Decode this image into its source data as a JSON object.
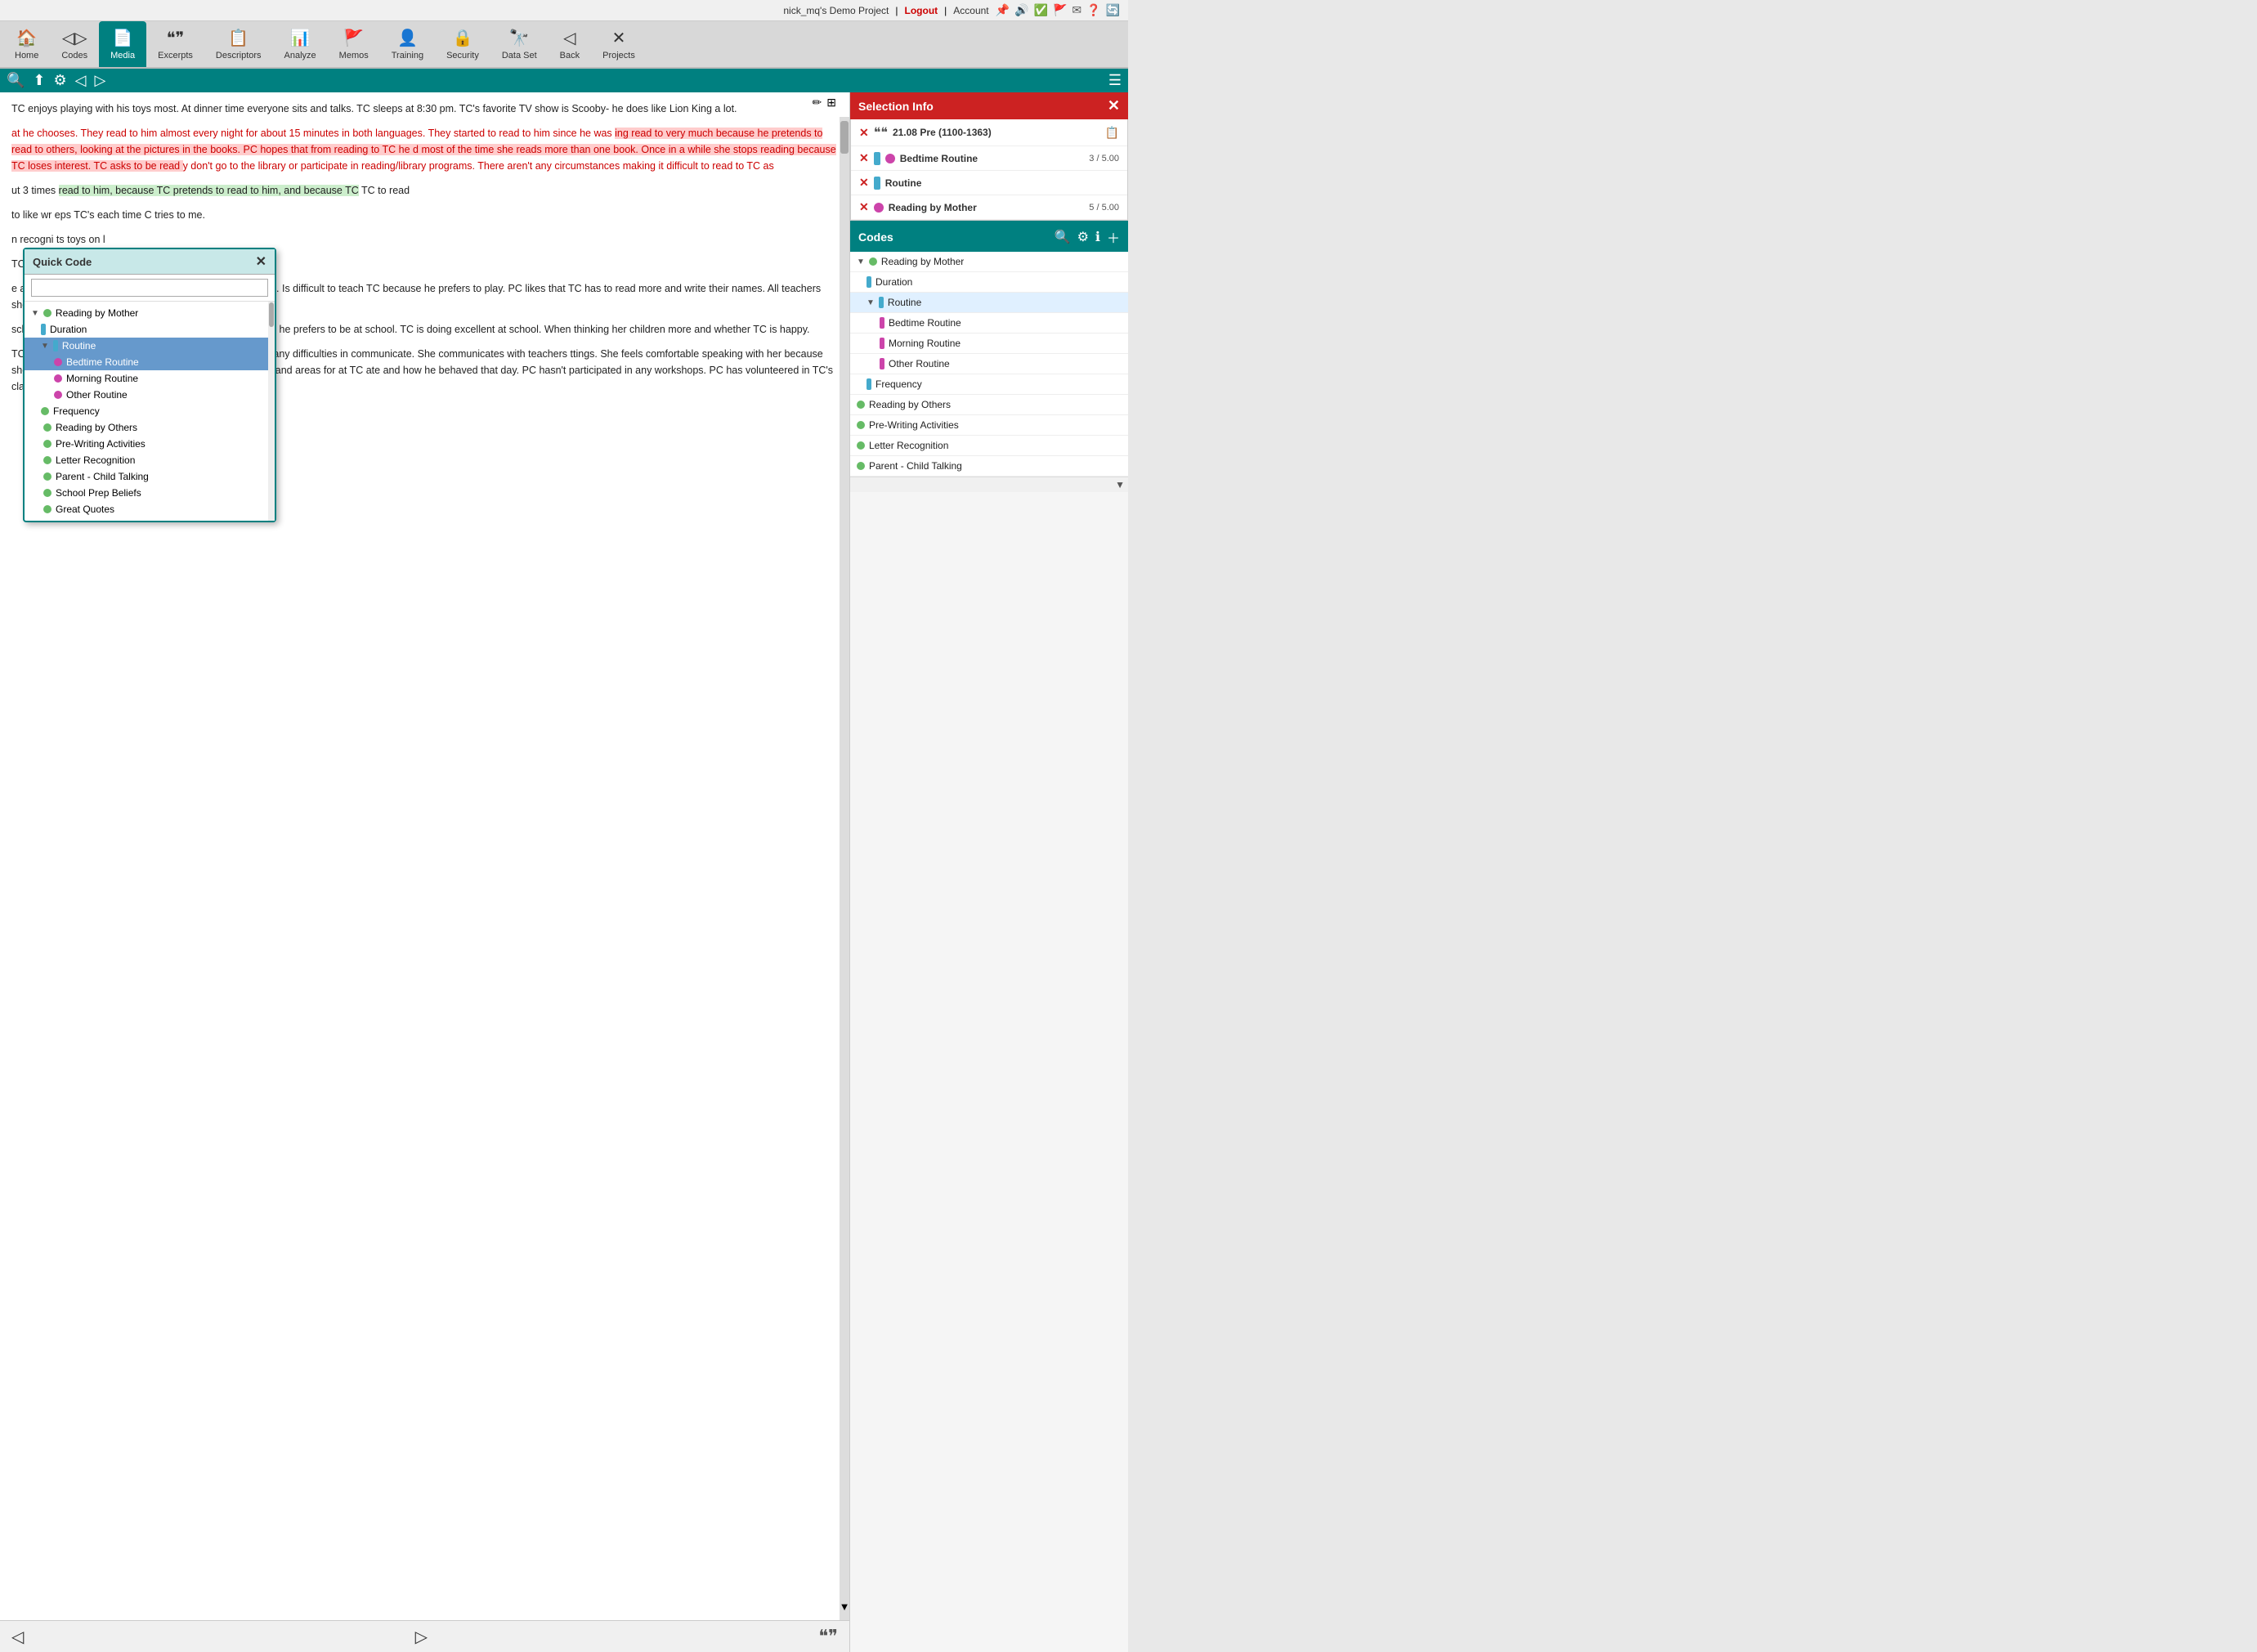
{
  "topbar": {
    "project": "nick_mq's Demo Project",
    "separator": "|",
    "logout": "Logout",
    "account": "Account"
  },
  "navbar": {
    "items": [
      {
        "id": "home",
        "label": "Home",
        "icon": "🏠"
      },
      {
        "id": "codes",
        "label": "Codes",
        "icon": "◁▷"
      },
      {
        "id": "media",
        "label": "Media",
        "icon": "📄",
        "active": true
      },
      {
        "id": "excerpts",
        "label": "Excerpts",
        "icon": "❝❞"
      },
      {
        "id": "descriptors",
        "label": "Descriptors",
        "icon": "📋"
      },
      {
        "id": "analyze",
        "label": "Analyze",
        "icon": "📊"
      },
      {
        "id": "memos",
        "label": "Memos",
        "icon": "🚩"
      },
      {
        "id": "training",
        "label": "Training",
        "icon": "👤"
      },
      {
        "id": "security",
        "label": "Security",
        "icon": "🔒"
      },
      {
        "id": "dataset",
        "label": "Data Set",
        "icon": "🔭"
      },
      {
        "id": "back",
        "label": "Back",
        "icon": "◁"
      },
      {
        "id": "projects",
        "label": "Projects",
        "icon": "✕"
      }
    ]
  },
  "toolbar": {
    "icons": [
      "🔍",
      "⬆",
      "⚙",
      "◁",
      "▷",
      "☰"
    ]
  },
  "text_panel": {
    "paragraphs": [
      "TC enjoys playing with his toys most. At dinner time everyone sits and talks. TC sleeps at 8:30 pm. TC's favorite TV show is Scooby- he does like Lion King a lot.",
      "at he chooses. They read to him almost every night for about 15 minutes in both languages. They started to read to him since he was ing read to very much because he pretends to read to others, looking at the pictures in the books. PC hopes that from reading to TC he d most of the time she reads more than one book. Once in a while she stops reading because TC loses interest. TC asks to be read y don't go to the library or participate in reading/library programs. There aren't any circumstances making it difficult to read to TC as",
      "ut 3 times read to him, because TC pretends to read to him, and because TC TC to read",
      "to like wr eps TC's each time C tries to me.",
      "n recogni ts toys on l",
      "TC partic",
      "e alphabe... The teacher is teaching TC the numbers now... Is difficult to teach TC because he prefers to play. PC likes that TC has to read more and write their names. All teachers should teach children to stay away from drugs and gangs.",
      "school for a doctor's appointment or for some other reason he prefers to be at school. TC is doing excellent at school. When thinking her children more and whether TC is happy.",
      "TC is doing in class and how he is behaving. There aren't any difficulties in communicate. She communicates with teachers ttings. She feels comfortable speaking with her because she's easy-going. They talk about what's lacking in school and areas for at TC ate and how he behaved that day. PC hasn't participated in any workshops. PC has volunteered in TC's classroom 3 times in"
    ],
    "highlight_para": "at he chooses. They read to him almost every night for about 15 minutes in both languages. They started to read to him since he was ing read to very much because he pretends to read to others, looking at the pictures in the books. PC hopes that from reading to TC he d most of the time she reads more than one book. Once in a while she stops reading because TC loses interest. TC asks to be read y don't go to the library or participate in reading/library programs. There aren't any circumstances making it difficult to read to TC as",
    "highlight_text3": "read to him, because TC pretends to read to him, and because TC"
  },
  "quick_code": {
    "title": "Quick Code",
    "search_placeholder": "",
    "items": [
      {
        "label": "Reading by Mother",
        "level": 0,
        "color": "#66bb66",
        "has_triangle": true,
        "expanded": true
      },
      {
        "label": "Duration",
        "level": 1,
        "color": "#44aacc",
        "has_triangle": false
      },
      {
        "label": "Routine",
        "level": 1,
        "color": "#44aacc",
        "has_triangle": true,
        "expanded": true,
        "selected": true
      },
      {
        "label": "Bedtime Routine",
        "level": 2,
        "color": "#cc44aa",
        "has_triangle": false,
        "selected": true
      },
      {
        "label": "Morning Routine",
        "level": 2,
        "color": "#cc44aa",
        "has_triangle": false
      },
      {
        "label": "Other Routine",
        "level": 2,
        "color": "#cc44aa",
        "has_triangle": false
      },
      {
        "label": "Frequency",
        "level": 1,
        "color": "#66bb66",
        "has_triangle": false
      },
      {
        "label": "Reading by Others",
        "level": 0,
        "color": "#66bb66",
        "has_triangle": false
      },
      {
        "label": "Pre-Writing Activities",
        "level": 0,
        "color": "#66bb66",
        "has_triangle": false
      },
      {
        "label": "Letter Recognition",
        "level": 0,
        "color": "#66bb66",
        "has_triangle": false
      },
      {
        "label": "Parent - Child Talking",
        "level": 0,
        "color": "#66bb66",
        "has_triangle": false
      },
      {
        "label": "School Prep Beliefs",
        "level": 0,
        "color": "#66bb66",
        "has_triangle": false
      },
      {
        "label": "Great Quotes",
        "level": 0,
        "color": "#66bb66",
        "has_triangle": false
      }
    ]
  },
  "selection_info": {
    "title": "Selection Info",
    "close": "✕",
    "record": {
      "label": "21.08 Pre (1100-1363)",
      "codes": [
        {
          "label": "Bedtime Routine",
          "score": "3 / 5.00",
          "dot_color": "#cc44aa",
          "bar_color": "#44aacc"
        },
        {
          "label": "Routine",
          "dot_color": null,
          "bar_color": "#44aacc"
        },
        {
          "label": "Reading by Mother",
          "score": "5 / 5.00",
          "dot_color": "#cc44aa",
          "bar_color": "#66bb66"
        }
      ]
    }
  },
  "codes_panel": {
    "title": "Codes",
    "items": [
      {
        "label": "Reading by Mother",
        "level": 0,
        "color": "#66bb66",
        "has_triangle": true,
        "triangle_dir": "▼"
      },
      {
        "label": "Duration",
        "level": 1,
        "color": "#44aacc",
        "bar": true
      },
      {
        "label": "Routine",
        "level": 1,
        "color": "#44aacc",
        "has_triangle": true,
        "triangle_dir": "▼",
        "active": true
      },
      {
        "label": "Bedtime Routine",
        "level": 2,
        "color": "#cc44aa",
        "bar": true
      },
      {
        "label": "Morning Routine",
        "level": 2,
        "color": "#cc44aa",
        "bar": true
      },
      {
        "label": "Other Routine",
        "level": 2,
        "color": "#cc44aa",
        "bar": true
      },
      {
        "label": "Frequency",
        "level": 1,
        "color": "#44aacc",
        "bar": true
      },
      {
        "label": "Reading by Others",
        "level": 0,
        "color": "#66bb66",
        "dot": true
      },
      {
        "label": "Pre-Writing Activities",
        "level": 0,
        "color": "#66bb66",
        "dot": true
      },
      {
        "label": "Letter Recognition",
        "level": 0,
        "color": "#66bb66",
        "dot": true
      },
      {
        "label": "Parent - Child Talking",
        "level": 0,
        "color": "#66bb66",
        "dot": true
      }
    ]
  },
  "colors": {
    "teal": "#008080",
    "red": "#cc2222",
    "pink_dot": "#cc44aa",
    "teal_bar": "#44aacc",
    "green_dot": "#66bb66"
  }
}
